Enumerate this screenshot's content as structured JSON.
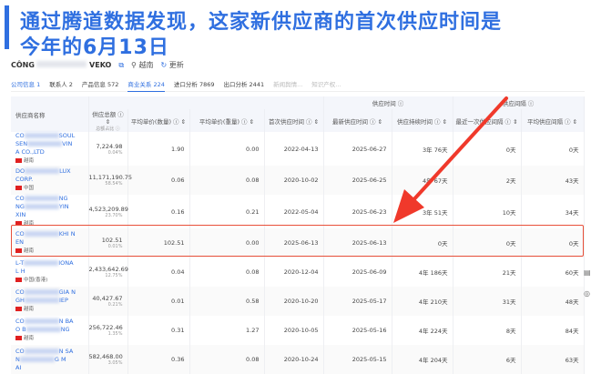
{
  "headline": {
    "line1": "通过腾道数据发现，这家新供应商的首次供应时间是",
    "line2": "今年的6月13日"
  },
  "company": {
    "name_start": "CÔNG",
    "name_end": "VEKO",
    "copy_icon": "copy-icon",
    "country": "越南",
    "refresh": "更新"
  },
  "tabs": [
    {
      "label": "公司信息 1",
      "active": false
    },
    {
      "label": "联系人 2"
    },
    {
      "label": "产品信息 572"
    },
    {
      "label": "商业关系 224",
      "active": true
    },
    {
      "label": "进口分析 7869"
    },
    {
      "label": "出口分析 2441"
    },
    {
      "label": "新闻舆情...",
      "disabled": true
    },
    {
      "label": "知识产权...",
      "disabled": true
    }
  ],
  "table": {
    "groups": {
      "supply_time": "供应时间 ⓘ",
      "supply_interval": "供应间隔 ⓘ"
    },
    "headers": {
      "name": "供应商名称",
      "total": "供应总额 ⓘ ⇕",
      "total_sub": "总额占比 ⓘ",
      "avg_qty": "平均单价(数量) ⓘ ⇕",
      "avg_wt": "平均单价(重量) ⓘ ⇕",
      "first": "首次供应时间 ⓘ ⇕",
      "latest": "最新供应时间 ⓘ ⇕",
      "duration": "供应持续时间 ⓘ ⇕",
      "last_interval": "最近一次供应间隔 ⓘ ⇕",
      "avg_interval": "平均供应间隔 ⓘ ⇕"
    },
    "rows": [
      {
        "n1": "CO",
        "n1e": "SOUL",
        "n2": "SEN",
        "n2e": "VIN",
        "n3": "A CO.,LTD",
        "country": "越南",
        "total": "7,224.98",
        "pct": "0.04%",
        "avg_qty": "1.90",
        "avg_wt": "0.00",
        "first": "2022-04-13",
        "latest": "2025-06-27",
        "duration": "3年 76天",
        "last": "0天",
        "avg": "0天"
      },
      {
        "n1": "DO",
        "n1e": "LUX",
        "n2": "CORP.",
        "n2e": "",
        "n3": "",
        "country": "中国",
        "total": "11,171,190.75",
        "pct": "58.54%",
        "avg_qty": "0.06",
        "avg_wt": "0.08",
        "first": "2020-10-02",
        "latest": "2025-06-25",
        "duration": "4年 67天",
        "last": "2天",
        "avg": "43天"
      },
      {
        "n1": "CO",
        "n1e": "NG",
        "n2": "NG",
        "n2e": "YIN",
        "n3": "XIN",
        "country": "越南",
        "total": "4,523,209.89",
        "pct": "23.70%",
        "avg_qty": "0.16",
        "avg_wt": "0.21",
        "first": "2022-05-04",
        "latest": "2025-06-23",
        "duration": "3年 51天",
        "last": "10天",
        "avg": "34天"
      },
      {
        "n1": "CO",
        "n1e": "KHI N",
        "n2": "EN",
        "n2e": "",
        "n3": "",
        "country": "越南",
        "total": "102.51",
        "pct": "0.01%",
        "avg_qty": "102.51",
        "avg_wt": "0.00",
        "first": "2025-06-13",
        "latest": "2025-06-13",
        "duration": "0天",
        "last": "0天",
        "avg": "0天"
      },
      {
        "n1": "L-T",
        "n1e": "IONA",
        "n2": "L H",
        "n2e": "",
        "n3": "",
        "country": "中国(香港)",
        "total": "2,433,642.69",
        "pct": "12.75%",
        "avg_qty": "0.04",
        "avg_wt": "0.08",
        "first": "2020-12-04",
        "latest": "2025-06-09",
        "duration": "4年 186天",
        "last": "21天",
        "avg": "60天"
      },
      {
        "n1": "CO",
        "n1e": "GIA N",
        "n2": "GH",
        "n2e": "IEP",
        "n3": "",
        "country": "越南",
        "total": "40,427.67",
        "pct": "0.21%",
        "avg_qty": "0.01",
        "avg_wt": "0.58",
        "first": "2020-10-20",
        "latest": "2025-05-17",
        "duration": "4年 210天",
        "last": "31天",
        "avg": "48天"
      },
      {
        "n1": "CO",
        "n1e": "N BA",
        "n2": "O B",
        "n2e": "NG",
        "n3": "",
        "country": "越南",
        "total": "256,722.46",
        "pct": "1.35%",
        "avg_qty": "0.31",
        "avg_wt": "1.27",
        "first": "2020-10-05",
        "latest": "2025-05-16",
        "duration": "4年 224天",
        "last": "8天",
        "avg": "84天"
      },
      {
        "n1": "CO",
        "n1e": "N SA",
        "n2": "N",
        "n2e": "G M",
        "n3": "AI",
        "country": "",
        "total": "582,468.00",
        "pct": "3.05%",
        "avg_qty": "0.36",
        "avg_wt": "0.08",
        "first": "2020-10-24",
        "latest": "2025-05-15",
        "duration": "4年 204天",
        "last": "6天",
        "avg": "63天"
      }
    ]
  },
  "colors": {
    "accent": "#2f6fe0",
    "highlight": "#e8503a",
    "arrow": "#f0392b"
  }
}
